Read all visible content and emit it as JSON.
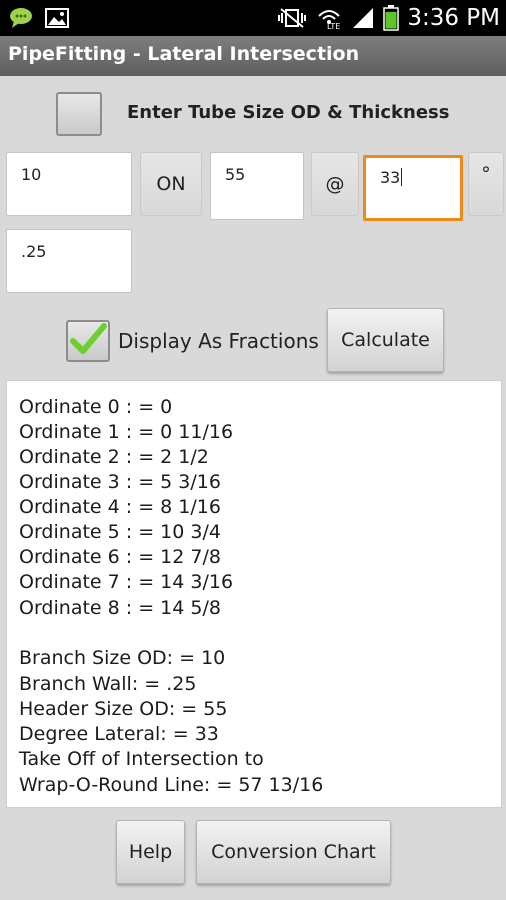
{
  "status_bar": {
    "time": "3:36 PM",
    "left_icons": [
      "chat-notification-icon",
      "image-notification-icon"
    ],
    "right_icons": [
      "vibrate-mute-icon",
      "lte-signal-icon",
      "cell-signal-icon",
      "battery-icon"
    ],
    "battery_level": 0.9
  },
  "app": {
    "title": "PipeFitting - Lateral Intersection"
  },
  "form": {
    "tube_checkbox_label": "Enter Tube Size OD & Thickness",
    "tube_checkbox_checked": false,
    "branch_od_value": "10",
    "on_label": "ON",
    "header_od_value": "55",
    "at_label": "@",
    "degree_value": "33",
    "degree_symbol": "°",
    "wall_value": ".25",
    "fractions_label": "Display As Fractions",
    "fractions_checked": true,
    "calculate_label": "Calculate"
  },
  "results": {
    "lines": [
      "Ordinate 0 : = 0",
      "Ordinate 1 : = 0 11/16",
      "Ordinate 2 : = 2 1/2",
      "Ordinate 3 : = 5 3/16",
      "Ordinate 4 : = 8 1/16",
      "Ordinate 5 : = 10 3/4",
      "Ordinate 6 : = 12 7/8",
      "Ordinate 7 : = 14 3/16",
      "Ordinate 8 : = 14 5/8",
      "",
      "Branch Size OD: = 10",
      "Branch Wall: = .25",
      "Header Size OD: = 55",
      "Degree Lateral: = 33",
      "Take Off of Intersection to",
      "Wrap-O-Round Line: = 57 13/16"
    ]
  },
  "footer": {
    "help_label": "Help",
    "conversion_label": "Conversion Chart"
  },
  "colors": {
    "focus": "#f08a16",
    "check": "#6ccf2e",
    "background": "#d9d9d9"
  }
}
